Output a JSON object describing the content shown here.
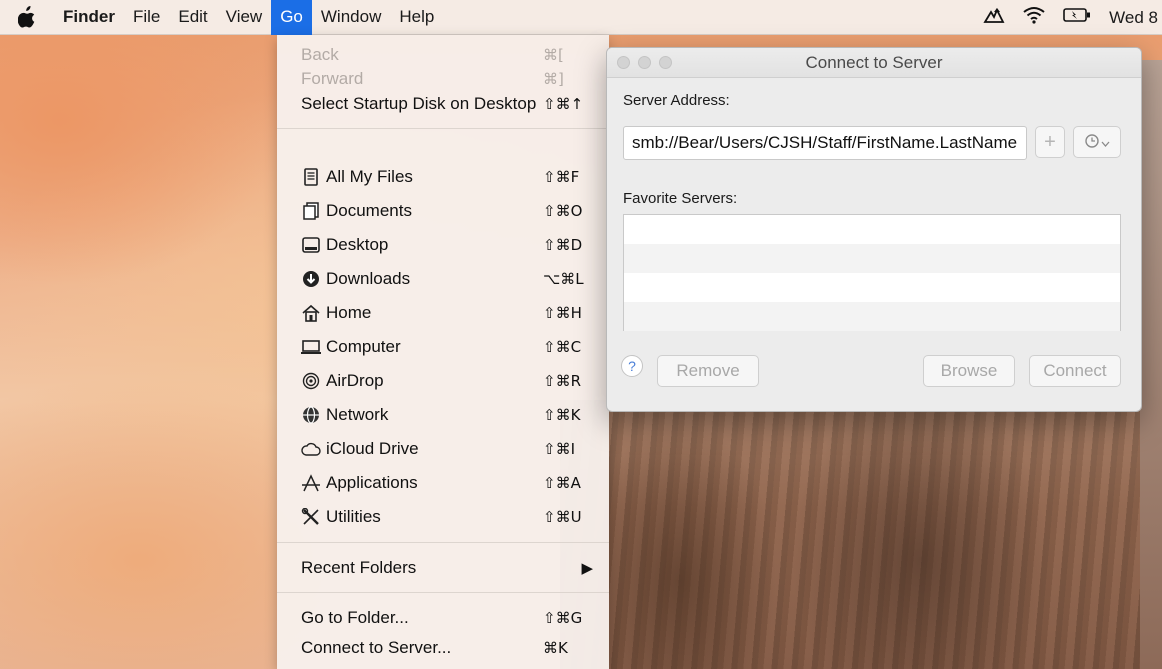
{
  "menubar": {
    "app_name": "Finder",
    "items": [
      "File",
      "Edit",
      "View",
      "Go",
      "Window",
      "Help"
    ],
    "active": "Go",
    "clock": "Wed 8",
    "status_icons": [
      "network-activity-icon",
      "wifi-icon",
      "battery-icon"
    ]
  },
  "go_menu": {
    "back": {
      "label": "Back",
      "shortcut": "⌘["
    },
    "forward": {
      "label": "Forward",
      "shortcut": "⌘]"
    },
    "startup": {
      "label": "Select Startup Disk on Desktop",
      "shortcut": "⇧⌘↑"
    },
    "places": [
      {
        "label": "All My Files",
        "shortcut": "⇧⌘F",
        "icon": "all-files-icon"
      },
      {
        "label": "Documents",
        "shortcut": "⇧⌘O",
        "icon": "documents-icon"
      },
      {
        "label": "Desktop",
        "shortcut": "⇧⌘D",
        "icon": "desktop-icon"
      },
      {
        "label": "Downloads",
        "shortcut": "⌥⌘L",
        "icon": "downloads-icon"
      },
      {
        "label": "Home",
        "shortcut": "⇧⌘H",
        "icon": "home-icon"
      },
      {
        "label": "Computer",
        "shortcut": "⇧⌘C",
        "icon": "computer-icon"
      },
      {
        "label": "AirDrop",
        "shortcut": "⇧⌘R",
        "icon": "airdrop-icon"
      },
      {
        "label": "Network",
        "shortcut": "⇧⌘K",
        "icon": "network-icon"
      },
      {
        "label": "iCloud Drive",
        "shortcut": "⇧⌘I",
        "icon": "icloud-icon"
      },
      {
        "label": "Applications",
        "shortcut": "⇧⌘A",
        "icon": "applications-icon"
      },
      {
        "label": "Utilities",
        "shortcut": "⇧⌘U",
        "icon": "utilities-icon"
      }
    ],
    "recent_folders": "Recent Folders",
    "go_to_folder": {
      "label": "Go to Folder...",
      "shortcut": "⇧⌘G"
    },
    "connect_to_server": {
      "label": "Connect to Server...",
      "shortcut": "⌘K"
    }
  },
  "connect_window": {
    "title": "Connect to Server",
    "server_address_label": "Server Address:",
    "server_address_value": "smb://Bear/Users/CJSH/Staff/FirstName.LastName",
    "favorite_servers_label": "Favorite Servers:",
    "help": "?",
    "plus": "+",
    "remove": "Remove",
    "browse": "Browse",
    "connect": "Connect"
  }
}
